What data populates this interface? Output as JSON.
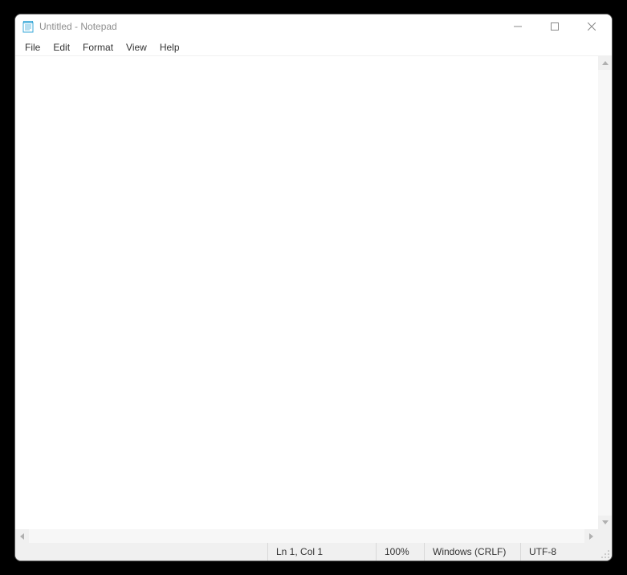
{
  "title": "Untitled - Notepad",
  "menus": {
    "file": "File",
    "edit": "Edit",
    "format": "Format",
    "view": "View",
    "help": "Help"
  },
  "editor": {
    "content": ""
  },
  "status": {
    "position": "Ln 1, Col 1",
    "zoom": "100%",
    "lineEnding": "Windows (CRLF)",
    "encoding": "UTF-8"
  }
}
